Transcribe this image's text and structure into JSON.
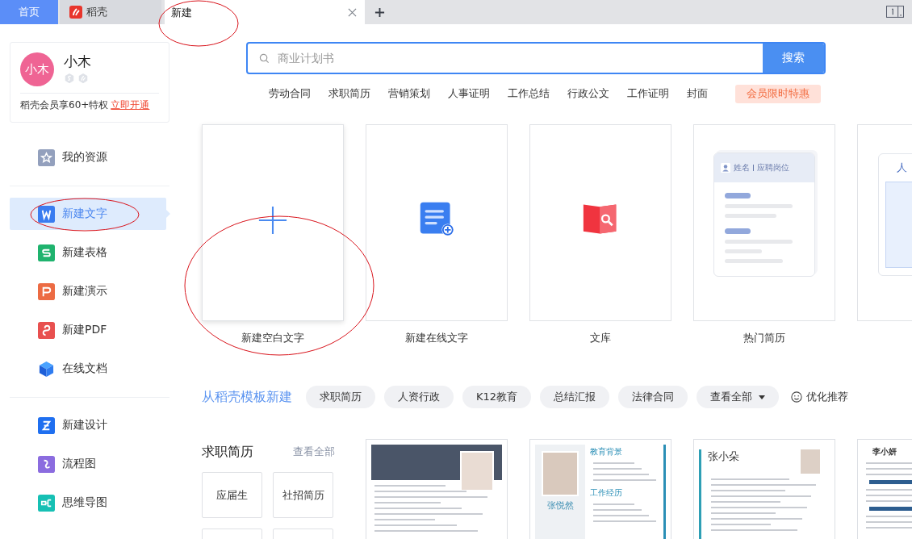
{
  "tabs": [
    {
      "kind": "home",
      "label": "首页",
      "selected": false
    },
    {
      "kind": "app",
      "label": "稻壳",
      "selected": false
    },
    {
      "kind": "page",
      "label": "新建",
      "selected": true
    }
  ],
  "profile": {
    "avatar_text": "小木",
    "name": "小木",
    "promo": "稻壳会员享60+特权",
    "promo_link": "立即开通"
  },
  "sidebar": {
    "groups": [
      {
        "items": [
          {
            "kind": "star",
            "label": "我的资源",
            "selected": false
          }
        ]
      },
      {
        "items": [
          {
            "kind": "writer",
            "label": "新建文字",
            "selected": true
          },
          {
            "kind": "sheet",
            "label": "新建表格",
            "selected": false
          },
          {
            "kind": "slides",
            "label": "新建演示",
            "selected": false
          },
          {
            "kind": "pdf",
            "label": "新建PDF",
            "selected": false
          },
          {
            "kind": "cloud",
            "label": "在线文档",
            "selected": false
          }
        ]
      },
      {
        "items": [
          {
            "kind": "design",
            "label": "新建设计",
            "selected": false
          },
          {
            "kind": "flow",
            "label": "流程图",
            "selected": false
          },
          {
            "kind": "mind",
            "label": "思维导图",
            "selected": false
          }
        ]
      }
    ]
  },
  "search": {
    "placeholder": "商业计划书",
    "button": "搜索"
  },
  "hot_tags": [
    {
      "kind": "tag",
      "label": "劳动合同"
    },
    {
      "kind": "tag",
      "label": "求职简历"
    },
    {
      "kind": "tag",
      "label": "营销策划"
    },
    {
      "kind": "tag",
      "label": "人事证明"
    },
    {
      "kind": "tag",
      "label": "工作总结"
    },
    {
      "kind": "tag",
      "label": "行政公文"
    },
    {
      "kind": "tag",
      "label": "工作证明"
    },
    {
      "kind": "tag",
      "label": "封面"
    },
    {
      "kind": "promo",
      "label": "会员限时特惠"
    }
  ],
  "create_cards": [
    {
      "kind": "blank",
      "label": "新建空白文字"
    },
    {
      "kind": "online",
      "label": "新建在线文字"
    },
    {
      "kind": "library",
      "label": "文库"
    },
    {
      "kind": "resume",
      "label": "热门简历",
      "name_field": "姓名",
      "position_field": "应聘岗位"
    },
    {
      "kind": "partial",
      "heading": "人"
    }
  ],
  "templates": {
    "title": "从稻壳模板新建",
    "chips": [
      {
        "kind": "chip",
        "label": "求职简历"
      },
      {
        "kind": "chip",
        "label": "人资行政"
      },
      {
        "kind": "chip",
        "label": "K12教育"
      },
      {
        "kind": "chip",
        "label": "总结汇报"
      },
      {
        "kind": "chip",
        "label": "法律合同"
      },
      {
        "kind": "dropdown",
        "label": "查看全部"
      }
    ],
    "recommend": "优化推荐"
  },
  "section": {
    "title": "求职简历",
    "more": "查看全部",
    "categories": [
      "应届生",
      "社招简历"
    ],
    "thumbnails": [
      {
        "kind": "banner"
      },
      {
        "kind": "sidebar",
        "name": "张悦然",
        "headings": [
          "教育背景",
          "工作经历"
        ]
      },
      {
        "kind": "plain",
        "name": "张小朵"
      },
      {
        "kind": "compact",
        "name": "李小妍"
      }
    ]
  }
}
